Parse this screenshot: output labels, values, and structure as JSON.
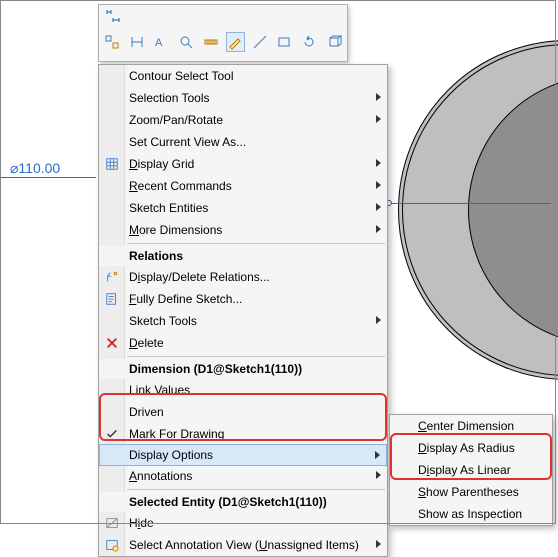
{
  "dimension": {
    "text": "⌀110.00"
  },
  "toolbar": {
    "row1": [
      "dimension-icon"
    ],
    "row2": [
      "mirror-icon",
      "sort-icon",
      "text-icon",
      "magnify-icon",
      "measure-icon",
      "highlight-icon",
      "line-icon",
      "rect-icon",
      "redo-icon",
      "view-icon"
    ]
  },
  "menu": {
    "items1": [
      {
        "label": "Contour Select Tool",
        "sub": false
      },
      {
        "label": "Selection Tools",
        "sub": true
      },
      {
        "label": "Zoom/Pan/Rotate",
        "sub": true
      },
      {
        "label": "Set Current View As...",
        "sub": false
      },
      {
        "label_html": "<u>D</u>isplay Grid",
        "sub": true,
        "icon": "grid-icon"
      },
      {
        "label_html": "<u>R</u>ecent Commands",
        "sub": true
      },
      {
        "label": "Sketch Entities",
        "sub": true
      },
      {
        "label_html": "<u>M</u>ore Dimensions",
        "sub": true
      }
    ],
    "header1": "Relations",
    "items2": [
      {
        "label_html": "D<u>i</u>splay/Delete Relations...",
        "icon": "relations-icon"
      },
      {
        "label_html": "<u>F</u>ully Define Sketch...",
        "icon": "define-icon"
      },
      {
        "label": "Sketch Tools",
        "sub": true
      },
      {
        "label_html": "<u>D</u>elete",
        "icon": "delete-icon"
      }
    ],
    "header2": "Dimension (D1@Sketch1(110))",
    "items3": [
      {
        "label": "Link Values"
      },
      {
        "label": "Driven"
      },
      {
        "label_html": "Mark <u>F</u>or Drawing",
        "icon": "check-icon"
      },
      {
        "label": "Display Options",
        "sub": true,
        "hover": true
      },
      {
        "label_html": "<u>A</u>nnotations",
        "sub": true
      }
    ],
    "header3": "Selected Entity (D1@Sketch1(110))",
    "items4": [
      {
        "label_html": "H<u>i</u>de",
        "icon": "hide-icon"
      },
      {
        "label_html": "Select Annotation View  (<u>U</u>nassigned Items)",
        "icon": "annot-icon",
        "sub": true
      }
    ]
  },
  "submenu": {
    "items": [
      {
        "label_html": "<u>C</u>enter Dimension"
      },
      {
        "label_html": "<u>D</u>isplay As Radius"
      },
      {
        "label_html": "D<u>i</u>splay As Linear"
      },
      {
        "label_html": "<u>S</u>how Parentheses"
      },
      {
        "label": "Show as Inspection"
      }
    ]
  }
}
